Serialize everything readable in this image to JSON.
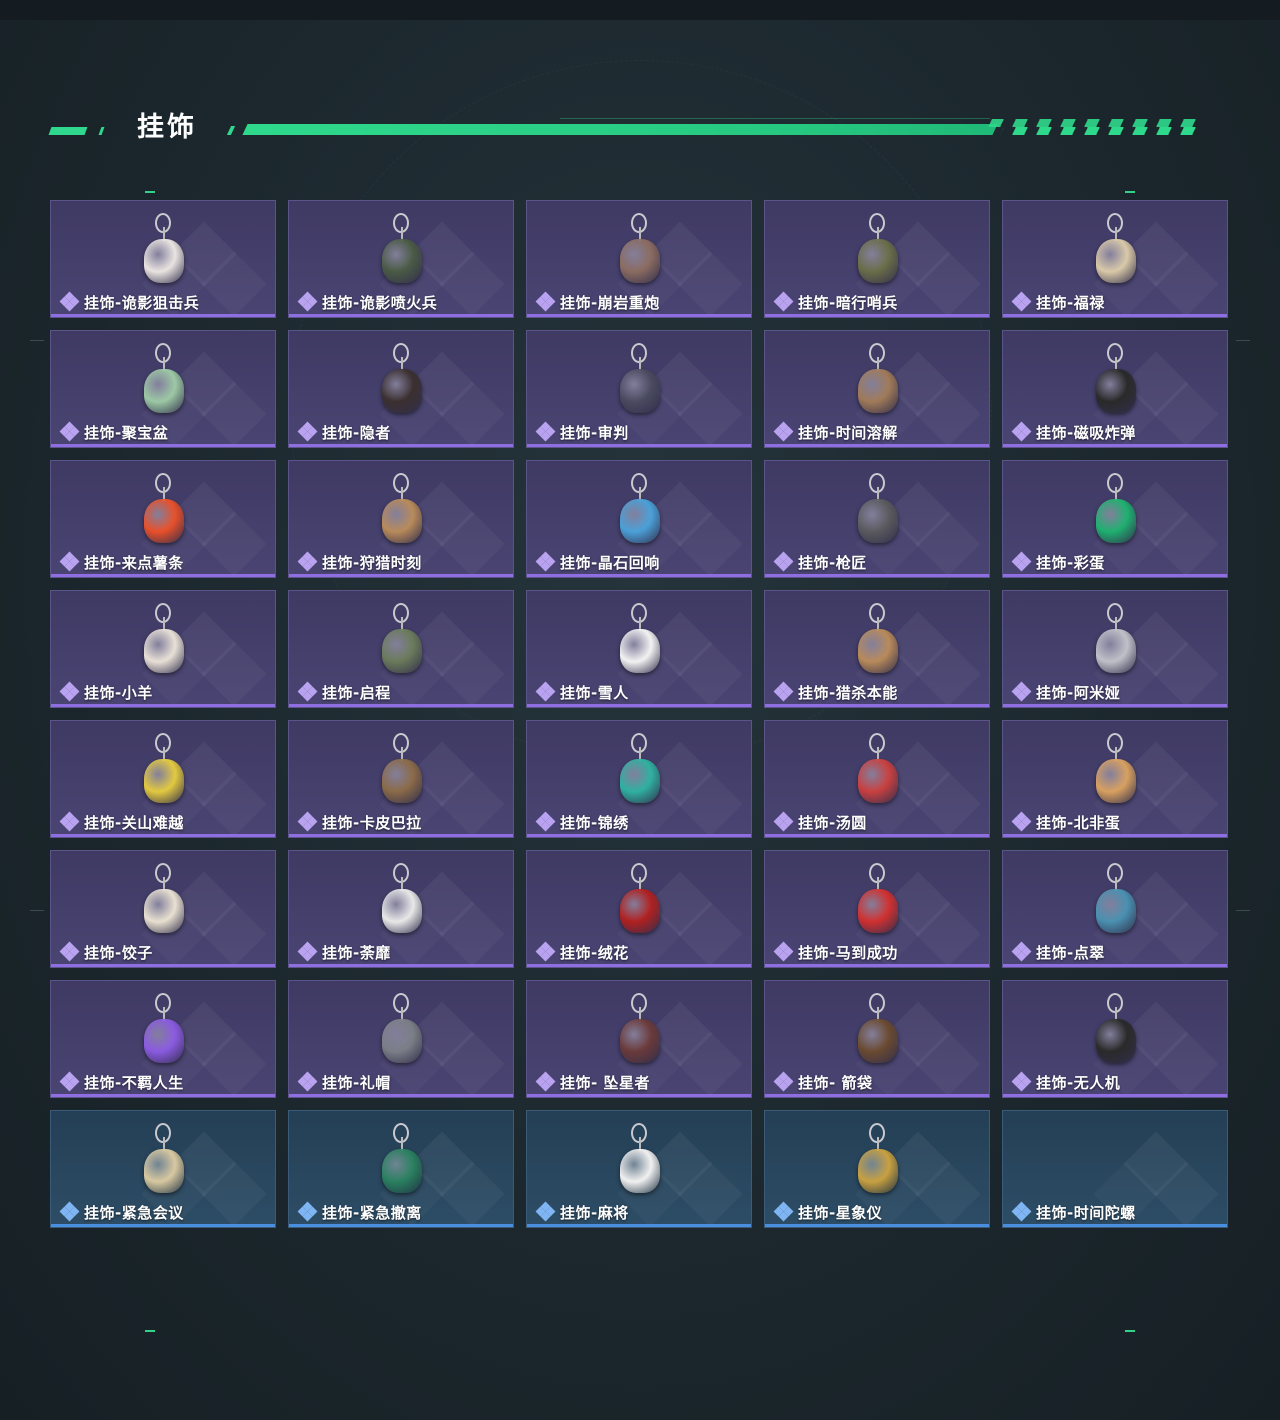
{
  "section": {
    "title": "挂饰"
  },
  "colors": {
    "accent_green": "#30d88e",
    "rarity_purple": "#8e6ee0",
    "rarity_blue": "#4a8ee0",
    "gem_purple": "#b9a3f0",
    "gem_blue": "#7fb5f2"
  },
  "items": [
    {
      "name": "挂饰-诡影狙击兵",
      "rarity": "purple",
      "icon": "soldier-charm-icon",
      "tint": "#e9e4e0"
    },
    {
      "name": "挂饰-诡影喷火兵",
      "rarity": "purple",
      "icon": "soldier-charm-icon",
      "tint": "#4a5a45"
    },
    {
      "name": "挂饰-崩岩重炮",
      "rarity": "purple",
      "icon": "soldier-charm-icon",
      "tint": "#8a6b60"
    },
    {
      "name": "挂饰-暗行哨兵",
      "rarity": "purple",
      "icon": "soldier-charm-icon",
      "tint": "#6a6d48"
    },
    {
      "name": "挂饰-福禄",
      "rarity": "purple",
      "icon": "gourd-charm-icon",
      "tint": "#d9c9a8"
    },
    {
      "name": "挂饰-聚宝盆",
      "rarity": "purple",
      "icon": "treasure-bowl-icon",
      "tint": "#9cc8a4"
    },
    {
      "name": "挂饰-隐者",
      "rarity": "purple",
      "icon": "tarot-card-icon",
      "tint": "#3b3030"
    },
    {
      "name": "挂饰-审判",
      "rarity": "purple",
      "icon": "tarot-card-icon",
      "tint": "#4a4a60"
    },
    {
      "name": "挂饰-时间溶解",
      "rarity": "purple",
      "icon": "melting-clock-icon",
      "tint": "#a07a58"
    },
    {
      "name": "挂饰-磁吸炸弹",
      "rarity": "purple",
      "icon": "bomb-charm-icon",
      "tint": "#2a2a2a"
    },
    {
      "name": "挂饰-来点薯条",
      "rarity": "purple",
      "icon": "fries-charm-icon",
      "tint": "#e8502a"
    },
    {
      "name": "挂饰-狩猎时刻",
      "rarity": "purple",
      "icon": "antler-charm-icon",
      "tint": "#b88a5a"
    },
    {
      "name": "挂饰-晶石回响",
      "rarity": "purple",
      "icon": "crystal-charm-icon",
      "tint": "#4aa0d8"
    },
    {
      "name": "挂饰-枪匠",
      "rarity": "purple",
      "icon": "workbench-charm-icon",
      "tint": "#5a5a5e"
    },
    {
      "name": "挂饰-彩蛋",
      "rarity": "purple",
      "icon": "egg-charm-icon",
      "tint": "#1fb070"
    },
    {
      "name": "挂饰-小羊",
      "rarity": "purple",
      "icon": "lamb-charm-icon",
      "tint": "#e8e0d6"
    },
    {
      "name": "挂饰-启程",
      "rarity": "purple",
      "icon": "compass-charm-icon",
      "tint": "#6a7a5a"
    },
    {
      "name": "挂饰-雪人",
      "rarity": "purple",
      "icon": "snowman-charm-icon",
      "tint": "#f2f2f2"
    },
    {
      "name": "挂饰-猎杀本能",
      "rarity": "purple",
      "icon": "antler-charm-icon",
      "tint": "#b88a5a"
    },
    {
      "name": "挂饰-阿米娅",
      "rarity": "purple",
      "icon": "bunny-charm-icon",
      "tint": "#c0c0c8"
    },
    {
      "name": "挂饰-关山难越",
      "rarity": "purple",
      "icon": "tube-charm-icon",
      "tint": "#e2c940"
    },
    {
      "name": "挂饰-卡皮巴拉",
      "rarity": "purple",
      "icon": "capybara-charm-icon",
      "tint": "#8a6a48"
    },
    {
      "name": "挂饰-锦绣",
      "rarity": "purple",
      "icon": "butterfly-charm-icon",
      "tint": "#2fb0a0"
    },
    {
      "name": "挂饰-汤圆",
      "rarity": "purple",
      "icon": "bowl-charm-icon",
      "tint": "#c84040"
    },
    {
      "name": "挂饰-北非蛋",
      "rarity": "purple",
      "icon": "pan-charm-icon",
      "tint": "#d8a060"
    },
    {
      "name": "挂饰-饺子",
      "rarity": "purple",
      "icon": "dumpling-charm-icon",
      "tint": "#e8e0d0"
    },
    {
      "name": "挂饰-荼靡",
      "rarity": "purple",
      "icon": "flower-charm-icon",
      "tint": "#e8e8e8"
    },
    {
      "name": "挂饰-绒花",
      "rarity": "purple",
      "icon": "rose-charm-icon",
      "tint": "#b02020"
    },
    {
      "name": "挂饰-马到成功",
      "rarity": "purple",
      "icon": "horse-charm-icon",
      "tint": "#d03030"
    },
    {
      "name": "挂饰-点翠",
      "rarity": "purple",
      "icon": "hairpin-charm-icon",
      "tint": "#4a90b0"
    },
    {
      "name": "挂饰-不羁人生",
      "rarity": "purple",
      "icon": "sneaker-charm-icon",
      "tint": "#8a5ae0"
    },
    {
      "name": "挂饰-礼帽",
      "rarity": "purple",
      "icon": "hat-charm-icon",
      "tint": "#7a7e86"
    },
    {
      "name": "挂饰- 坠星者",
      "rarity": "purple",
      "icon": "triangle-charm-icon",
      "tint": "#6a3a3a"
    },
    {
      "name": "挂饰- 箭袋",
      "rarity": "purple",
      "icon": "quiver-charm-icon",
      "tint": "#6a4a30"
    },
    {
      "name": "挂饰-无人机",
      "rarity": "purple",
      "icon": "drone-charm-icon",
      "tint": "#2a2a2a"
    },
    {
      "name": "挂饰-紧急会议",
      "rarity": "blue",
      "icon": "meeting-charm-icon",
      "tint": "#d8c8a0"
    },
    {
      "name": "挂饰-紧急撤离",
      "rarity": "blue",
      "icon": "cube-charm-icon",
      "tint": "#2a8060"
    },
    {
      "name": "挂饰-麻将",
      "rarity": "blue",
      "icon": "mahjong-charm-icon",
      "tint": "#f0f0f0"
    },
    {
      "name": "挂饰-星象仪",
      "rarity": "blue",
      "icon": "astrolabe-charm-icon",
      "tint": "#c8a040"
    },
    {
      "name": "挂饰-时间陀螺",
      "rarity": "blue",
      "icon": "",
      "tint": ""
    }
  ]
}
